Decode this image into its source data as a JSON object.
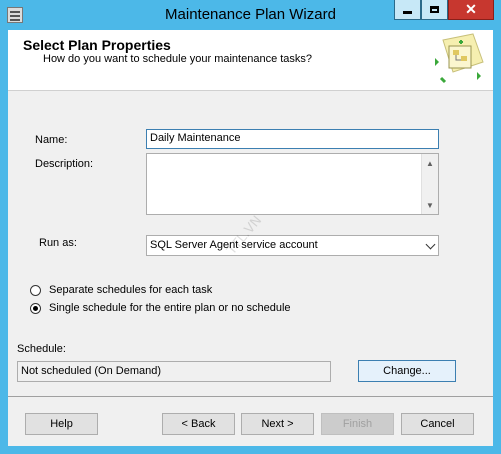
{
  "window": {
    "title": "Maintenance Plan Wizard"
  },
  "header": {
    "title": "Select Plan Properties",
    "subtitle": "How do you want to schedule your maintenance tasks?"
  },
  "form": {
    "name_label": "Name:",
    "name_value": "Daily Maintenance",
    "description_label": "Description:",
    "description_value": "",
    "runas_label": "Run as:",
    "runas_value": "SQL Server Agent service account"
  },
  "schedule_options": [
    {
      "label": "Separate schedules for each task",
      "checked": false
    },
    {
      "label": "Single schedule for the entire plan or no schedule",
      "checked": true
    }
  ],
  "schedule": {
    "label": "Schedule:",
    "value": "Not scheduled (On Demand)",
    "change_label": "Change..."
  },
  "footer": {
    "help": "Help",
    "back": "< Back",
    "next": "Next >",
    "finish": "Finish",
    "cancel": "Cancel"
  },
  "watermark": "TTL.VN",
  "colors": {
    "titlebar": "#4cb8e8",
    "close_button": "#c7372f",
    "focus_border": "#3c7fb1"
  }
}
